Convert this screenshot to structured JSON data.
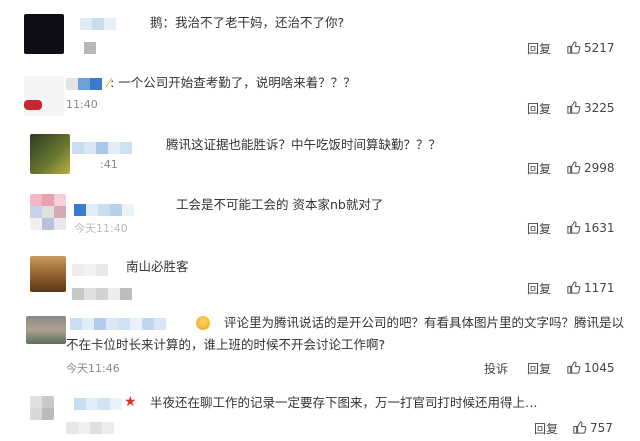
{
  "comments": [
    {
      "text": "鹅：我治不了老干妈，还治不了你?",
      "time": "",
      "action": "回复",
      "likes": "5217"
    },
    {
      "text": "一个公司开始查考勤了，说明啥来着？？？",
      "time": "11:40",
      "action": "回复",
      "likes": "3225"
    },
    {
      "text": "腾讯这证据也能胜诉？中午吃饭时间算缺勤？？？",
      "time": ":41",
      "action": "回复",
      "likes": "2998"
    },
    {
      "text": "工会是不可能工会的 资本家nb就对了",
      "time": "今天11:40",
      "action": "回复",
      "likes": "1631"
    },
    {
      "text": "南山必胜客",
      "time": "",
      "action": "回复",
      "likes": "1171"
    },
    {
      "text": "评论里为腾讯说话的是开公司的吧？有看具体图片里的文字吗？腾讯是以不在卡位时长来计算的，谁上班的时候不开会讨论工作啊?",
      "time": "今天11:46",
      "action": "投诉",
      "action2": "回复",
      "likes": "1045"
    },
    {
      "text": "半夜还在聊工作的记录一定要存下图来，万一打官司打时候还用得上…",
      "time": "",
      "action": "回复",
      "likes": "757"
    }
  ],
  "colors": {
    "text": "#333333",
    "meta": "#888888",
    "divider": "#eeeeee"
  }
}
